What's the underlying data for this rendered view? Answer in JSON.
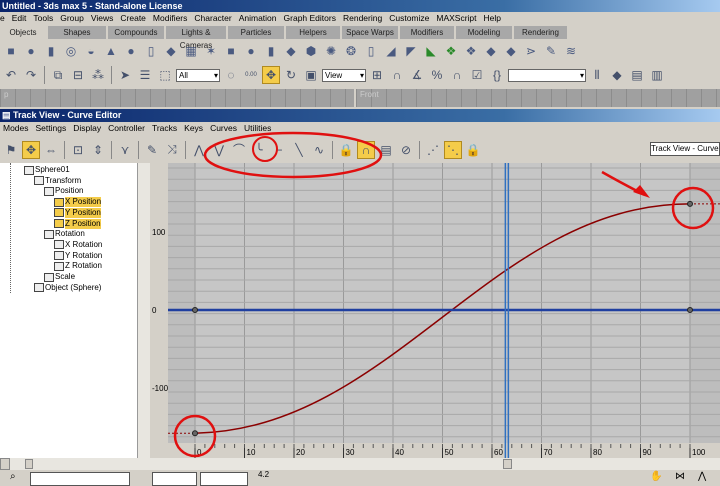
{
  "app_title": "Untitled - 3ds max 5 - Stand-alone License",
  "menu": [
    "e",
    "Edit",
    "Tools",
    "Group",
    "Views",
    "Create",
    "Modifiers",
    "Character",
    "Animation",
    "Graph Editors",
    "Rendering",
    "Customize",
    "MAXScript",
    "Help"
  ],
  "tabs": [
    {
      "label": "Objects",
      "active": true
    },
    {
      "label": "Shapes"
    },
    {
      "label": "Compounds"
    },
    {
      "label": "Lights & Cameras"
    },
    {
      "label": "Particles"
    },
    {
      "label": "Helpers"
    },
    {
      "label": "Space Warps"
    },
    {
      "label": "Modifiers"
    },
    {
      "label": "Modeling"
    },
    {
      "label": "Rendering"
    }
  ],
  "create_icons": [
    "box-icon",
    "sphere-icon",
    "cylinder-icon",
    "torus-icon",
    "teapot-icon",
    "cone-icon",
    "geosphere-icon",
    "tube-icon",
    "pyramid-icon",
    "plane-icon",
    "hedra-icon",
    "chamferbox-icon",
    "chamfercyl-icon",
    "oiltank-icon",
    "spindle-icon",
    "gengon-icon",
    "ringwave-icon",
    "torusknot-icon",
    "capsule-icon",
    "lext-icon",
    "cext-icon",
    "prism-icon",
    "boolean-icon",
    "scatter-icon",
    "loft-icon",
    "morph-icon",
    "connect-icon",
    "bone-icon",
    "spring-icon"
  ],
  "main_toolbar": {
    "selection_filter": "All",
    "ref_coord": "View",
    "named_selection": "",
    "spinner_label": "0.00"
  },
  "viewports": {
    "left_label": "p",
    "right_label": "Front"
  },
  "trackview": {
    "title": "Track View - Curve Editor",
    "menu": [
      "Modes",
      "Settings",
      "Display",
      "Controller",
      "Tracks",
      "Keys",
      "Curves",
      "Utilities"
    ],
    "name_field": "Track View - Curve E",
    "tree": [
      {
        "label": "Sphere01",
        "level": 0
      },
      {
        "label": "Transform",
        "level": 1
      },
      {
        "label": "Position",
        "level": 2
      },
      {
        "label": "X Position",
        "level": 3,
        "selected": true
      },
      {
        "label": "Y Position",
        "level": 3,
        "selected": true
      },
      {
        "label": "Z Position",
        "level": 3,
        "selected": true
      },
      {
        "label": "Rotation",
        "level": 2
      },
      {
        "label": "X Rotation",
        "level": 3
      },
      {
        "label": "Y Rotation",
        "level": 3
      },
      {
        "label": "Z Rotation",
        "level": 3
      },
      {
        "label": "Scale",
        "level": 2
      },
      {
        "label": "Object (Sphere)",
        "level": 1
      }
    ],
    "status_readout": "4.2"
  },
  "chart_data": {
    "type": "line",
    "xlim": [
      -5,
      105
    ],
    "ylim": [
      -170,
      170
    ],
    "x_ticks": [
      0,
      10,
      20,
      30,
      40,
      50,
      60,
      70,
      80,
      90,
      100
    ],
    "y_ticks": [
      100,
      0,
      -100
    ],
    "current_frame": 63,
    "series": [
      {
        "name": "X Position",
        "color": "#8b0000",
        "keys": [
          {
            "frame": 0,
            "value": -158
          },
          {
            "frame": 100,
            "value": 136
          }
        ]
      },
      {
        "name": "Y/Z Position",
        "color": "#1f3fa0",
        "keys": [
          {
            "frame": 0,
            "value": 0
          },
          {
            "frame": 100,
            "value": 0
          }
        ]
      }
    ]
  },
  "colors": {
    "highlight": "#f4cc4a",
    "annotation": "#e01010"
  }
}
